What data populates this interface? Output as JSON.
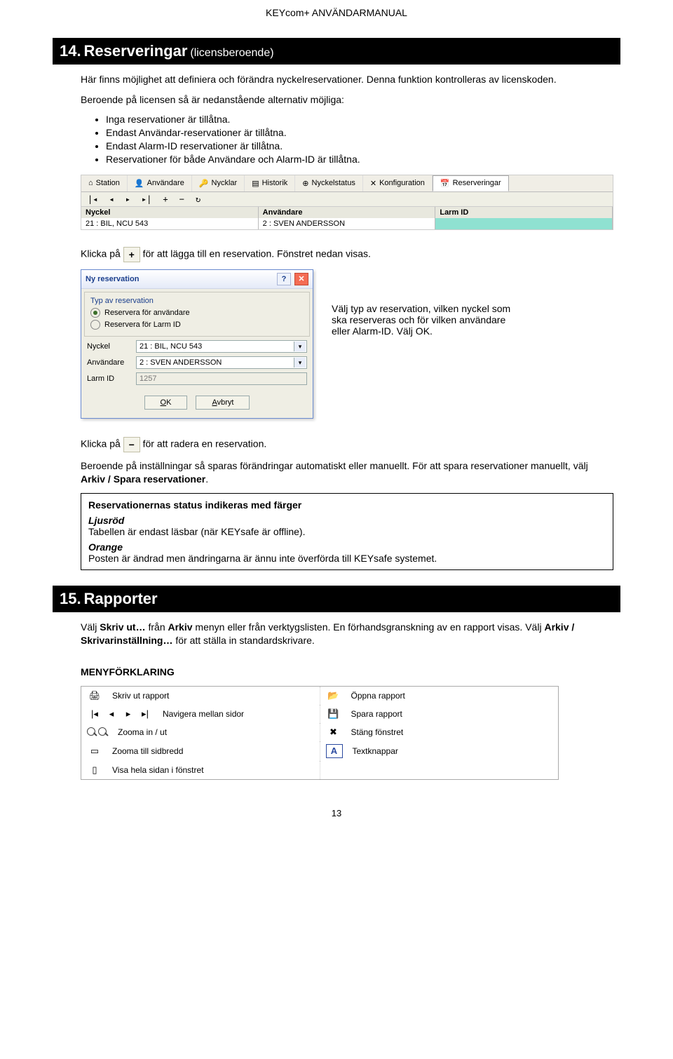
{
  "header": {
    "title": "KEYcom+ ANVÄNDARMANUAL"
  },
  "section14": {
    "number": "14.",
    "title": "Reserveringar",
    "paren": "(licensberoende)",
    "intro": "Här finns möjlighet att definiera och förändra nyckelreservationer. Denna funktion kontrolleras av licenskoden.",
    "pretext": "Beroende på licensen så är nedanstående alternativ möjliga:",
    "bullets": [
      "Inga reservationer är tillåtna.",
      "Endast Användar-reservationer är tillåtna.",
      "Endast Alarm-ID reservationer är tillåtna.",
      "Reservationer för både Användare och Alarm-ID är tillåtna."
    ]
  },
  "toolbar": {
    "tabs": [
      "Station",
      "Användare",
      "Nycklar",
      "Historik",
      "Nyckelstatus",
      "Konfiguration",
      "Reserveringar"
    ],
    "nav": [
      "|◂",
      "◂",
      "▸",
      "▸|",
      "+",
      "−",
      "↻"
    ],
    "columns": [
      "Nyckel",
      "Användare",
      "Larm ID"
    ],
    "row": [
      "21  : BIL, NCU 543",
      "2  : SVEN ANDERSSON",
      ""
    ]
  },
  "klicka_add": {
    "pre": "Klicka på",
    "post": "för att lägga till en reservation. Fönstret nedan visas."
  },
  "dialog": {
    "title": "Ny reservation",
    "group_title": "Typ av reservation",
    "radio1": "Reservera för användare",
    "radio2": "Reservera för Larm ID",
    "field1_label": "Nyckel",
    "field1_value": "21  : BIL, NCU 543",
    "field2_label": "Användare",
    "field2_value": "2  : SVEN ANDERSSON",
    "field3_label": "Larm ID",
    "field3_value": "1257",
    "ok": "OK",
    "cancel": "Avbryt",
    "desc": "Välj typ av reservation, vilken nyckel som ska reserveras och för vilken användare eller Alarm-ID. Välj OK."
  },
  "klicka_del": {
    "pre": "Klicka på",
    "post": "för att radera en reservation."
  },
  "save_text": {
    "l1": "Beroende på inställningar så sparas förändringar automatiskt eller manuellt. För att spara reservationer manuellt, välj ",
    "bold": "Arkiv / Spara reservationer",
    "tail": "."
  },
  "statusbox": {
    "hdr": "Reservationernas status indikeras med färger",
    "c1_label": "Ljusröd",
    "c1_text": "Tabellen är endast läsbar (när KEYsafe är offline).",
    "c2_label": "Orange",
    "c2_text": "Posten är ändrad men ändringarna är ännu inte överförda till KEYsafe systemet."
  },
  "section15": {
    "number": "15.",
    "title": "Rapporter",
    "p1a": "Välj ",
    "p1b": "Skriv ut…",
    "p1c": " från ",
    "p1d": "Arkiv",
    "p1e": " menyn eller från verktygslisten. En förhandsgranskning av en rapport visas. Välj ",
    "p1f": "Arkiv / Skrivarinställning…",
    "p1g": " för att ställa in standardskrivare.",
    "menu_header": "MENYFÖRKLARING",
    "menu": {
      "l1": "Skriv ut rapport",
      "r1": "Öppna rapport",
      "l2": "Navigera mellan sidor",
      "r2": "Spara rapport",
      "l3": "Zooma in / ut",
      "r3": "Stäng fönstret",
      "l4": "Zooma till sidbredd",
      "r4": "Textknappar",
      "l5": "Visa hela sidan i fönstret"
    }
  },
  "pagenum": "13"
}
